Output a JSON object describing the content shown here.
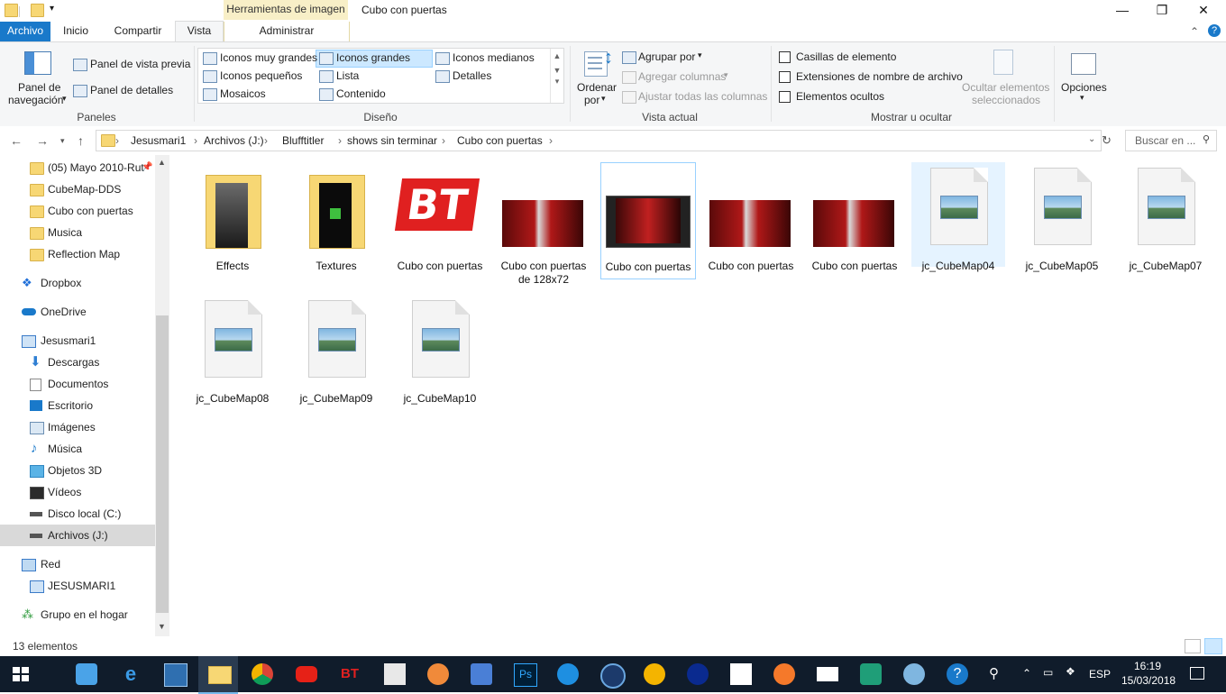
{
  "window": {
    "title": "Cubo con puertas",
    "contextual_tab_group": "Herramientas de imagen",
    "minimize": "—",
    "maximize": "❐",
    "close": "✕"
  },
  "tabs": {
    "file": "Archivo",
    "home": "Inicio",
    "share": "Compartir",
    "view": "Vista",
    "manage": "Administrar"
  },
  "ribbon": {
    "panes": {
      "nav_pane": "Panel de navegación",
      "nav_pane_line1": "Panel de",
      "nav_pane_line2": "navegación",
      "preview": "Panel de vista previa",
      "details": "Panel de detalles",
      "group": "Paneles"
    },
    "layout": {
      "xl_icons": "Iconos muy grandes",
      "large_icons": "Iconos grandes",
      "medium_icons": "Iconos medianos",
      "small_icons": "Iconos pequeños",
      "list": "Lista",
      "details": "Detalles",
      "tiles": "Mosaicos",
      "content": "Contenido",
      "group": "Diseño",
      "selected": "Iconos grandes"
    },
    "current_view": {
      "sort_line1": "Ordenar",
      "sort_line2": "por",
      "group_by": "Agrupar por",
      "add_columns": "Agregar columnas",
      "fit_columns": "Ajustar todas las columnas",
      "group": "Vista actual"
    },
    "show_hide": {
      "checkboxes": "Casillas de elemento",
      "extensions": "Extensiones de nombre de archivo",
      "hidden": "Elementos ocultos",
      "hide_selected_line1": "Ocultar elementos",
      "hide_selected_line2": "seleccionados",
      "group": "Mostrar u ocultar"
    },
    "options": "Opciones"
  },
  "address": {
    "crumbs": [
      "Jesusmari1",
      "Archivos (J:)",
      "Blufftitler",
      "shows sin terminar",
      "Cubo con puertas"
    ],
    "search_placeholder": "Buscar en ..."
  },
  "nav": {
    "quick_access": [
      "(05) Mayo 2010-Rut",
      "CubeMap-DDS",
      "Cubo con puertas",
      "Musica",
      "Reflection Map"
    ],
    "dropbox": "Dropbox",
    "onedrive": "OneDrive",
    "this_pc": "Jesusmari1",
    "pc_items": [
      "Descargas",
      "Documentos",
      "Escritorio",
      "Imágenes",
      "Música",
      "Objetos 3D",
      "Vídeos",
      "Disco local (C:)",
      "Archivos (J:)"
    ],
    "network": "Red",
    "network_pc": "JESUSMARI1",
    "homegroup": "Grupo en el hogar"
  },
  "files": [
    {
      "name": "Effects",
      "type": "folder"
    },
    {
      "name": "Textures",
      "type": "folder"
    },
    {
      "name": "Cubo con puertas",
      "type": "bt-logo"
    },
    {
      "name": "Cubo con puertas de 128x72",
      "type": "image-thumb"
    },
    {
      "name": "Cubo con puertas",
      "type": "video-thumb"
    },
    {
      "name": "Cubo con puertas",
      "type": "image-thumb"
    },
    {
      "name": "Cubo con puertas",
      "type": "image-thumb"
    },
    {
      "name": "jc_CubeMap04",
      "type": "picture-doc"
    },
    {
      "name": "jc_CubeMap05",
      "type": "picture-doc"
    },
    {
      "name": "jc_CubeMap07",
      "type": "picture-doc"
    },
    {
      "name": "jc_CubeMap08",
      "type": "picture-doc"
    },
    {
      "name": "jc_CubeMap09",
      "type": "picture-doc"
    },
    {
      "name": "jc_CubeMap10",
      "type": "picture-doc"
    }
  ],
  "status": {
    "count": "13 elementos"
  },
  "taskbar": {
    "language": "ESP",
    "time": "16:19",
    "date": "15/03/2018"
  },
  "colors": {
    "accent": "#1979ca",
    "selection": "#cce8ff",
    "taskbar": "#101c2b"
  }
}
